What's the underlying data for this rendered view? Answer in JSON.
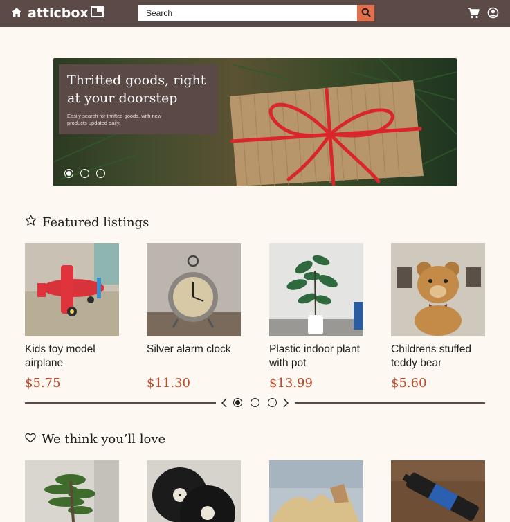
{
  "header": {
    "logo_text": "atticbox",
    "search_placeholder": "Search",
    "icons": [
      "home-icon",
      "box-icon",
      "search-icon",
      "cart-icon",
      "account-icon"
    ],
    "bar_color": "#5b4a46",
    "accent_color": "#e46f4b"
  },
  "hero": {
    "title": "Thrifted goods, right at your doorstep",
    "subtitle": "Easily search for thrifted goods, with new products updated daily.",
    "slide_count": 3,
    "active_slide": 1
  },
  "featured": {
    "title": "Featured listings",
    "icon": "star-icon",
    "items": [
      {
        "name": "Kids toy model airplane",
        "price": "$5.75",
        "image": "toy-airplane"
      },
      {
        "name": "Silver alarm clock",
        "price": "$11.30",
        "image": "alarm-clock"
      },
      {
        "name": "Plastic indoor plant with pot",
        "price": "$13.99",
        "image": "indoor-plant"
      },
      {
        "name": "Childrens stuffed teddy bear",
        "price": "$5.60",
        "image": "teddy-bear"
      }
    ],
    "pager": {
      "pages": 3,
      "active": 1
    },
    "price_color": "#c14a2a"
  },
  "recommended": {
    "title": "We think you’ll love",
    "icon": "heart-icon",
    "items": [
      {
        "image": "bonsai-tree"
      },
      {
        "image": "vinyl-records"
      },
      {
        "image": "wooden-toys"
      },
      {
        "image": "telescope"
      }
    ]
  }
}
